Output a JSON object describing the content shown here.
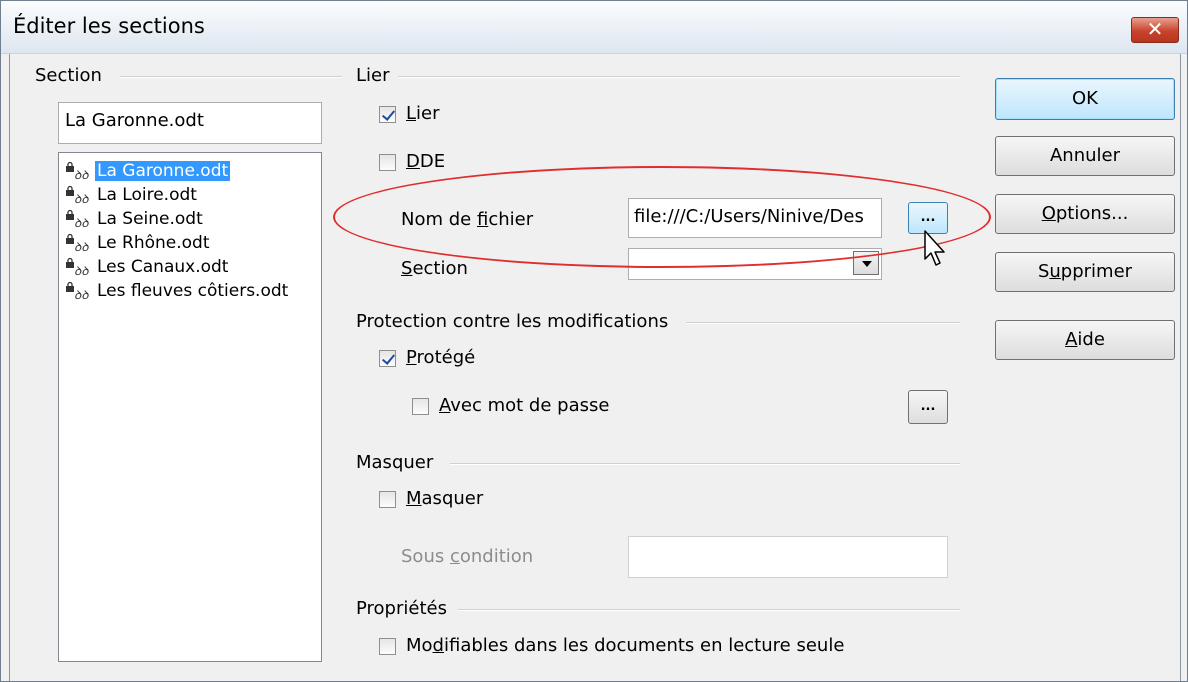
{
  "window": {
    "title": "Éditer les sections",
    "close_glyph": "✕"
  },
  "section_group": {
    "label": "Section",
    "current_value": "La Garonne.odt",
    "items": [
      {
        "label": "La Garonne.odt",
        "selected": true,
        "icons": [
          "lock-icon",
          "link-icon"
        ]
      },
      {
        "label": "La Loire.odt",
        "selected": false,
        "icons": [
          "lock-icon",
          "link-icon"
        ]
      },
      {
        "label": "La Seine.odt",
        "selected": false,
        "icons": [
          "lock-icon",
          "link-icon"
        ]
      },
      {
        "label": "Le Rhône.odt",
        "selected": false,
        "icons": [
          "lock-icon",
          "link-icon"
        ]
      },
      {
        "label": "Les Canaux.odt",
        "selected": false,
        "icons": [
          "lock-icon",
          "link-icon"
        ]
      },
      {
        "label": "Les fleuves côtiers.odt",
        "selected": false,
        "icons": [
          "lock-icon",
          "link-icon"
        ]
      }
    ]
  },
  "link_group": {
    "label": "Lier",
    "link_checkbox": {
      "label": "Lier",
      "mnemonic": "L",
      "rest": "ier",
      "checked": true
    },
    "dde_checkbox": {
      "label": "DDE",
      "mnemonic": "D",
      "rest": "DE",
      "checked": false
    },
    "filename_label": {
      "before": "Nom de ",
      "mnemonic": "f",
      "after": "ichier"
    },
    "filename_value": "file:///C:/Users/Ninive/Des",
    "browse_button": "...",
    "section_label": {
      "mnemonic": "S",
      "rest": "ection"
    },
    "section_value": ""
  },
  "protection_group": {
    "label": "Protection contre les modifications",
    "protected_checkbox": {
      "label": "Protégé",
      "mnemonic": "P",
      "rest": "rotégé",
      "checked": true
    },
    "password_checkbox": {
      "label": "Avec mot de passe",
      "mnemonic": "A",
      "rest": "vec mot de passe",
      "checked": false
    },
    "password_button": "..."
  },
  "hide_group": {
    "label": "Masquer",
    "hide_checkbox": {
      "label": "Masquer",
      "mnemonic": "M",
      "rest": "asquer",
      "checked": false
    },
    "condition_label": {
      "before": "Sous ",
      "mnemonic": "c",
      "after": "ondition"
    },
    "condition_value": ""
  },
  "properties_group": {
    "label": "Propriétés",
    "editable_checkbox": {
      "label": "Modifiables dans les documents en lecture seule",
      "before": "Mo",
      "mnemonic": "d",
      "after": "ifiables dans les documents en lecture seule",
      "checked": false
    }
  },
  "buttons": {
    "ok": "OK",
    "cancel": "Annuler",
    "options": {
      "mnemonic": "O",
      "rest": "ptions..."
    },
    "delete": {
      "before": "S",
      "mnemonic": "u",
      "after": "pprimer"
    },
    "help": {
      "mnemonic": "A",
      "rest": "ide"
    }
  },
  "colors": {
    "selection": "#3399ff",
    "annotation_ellipse": "#e02d2d",
    "default_button": "#bee6fd"
  }
}
